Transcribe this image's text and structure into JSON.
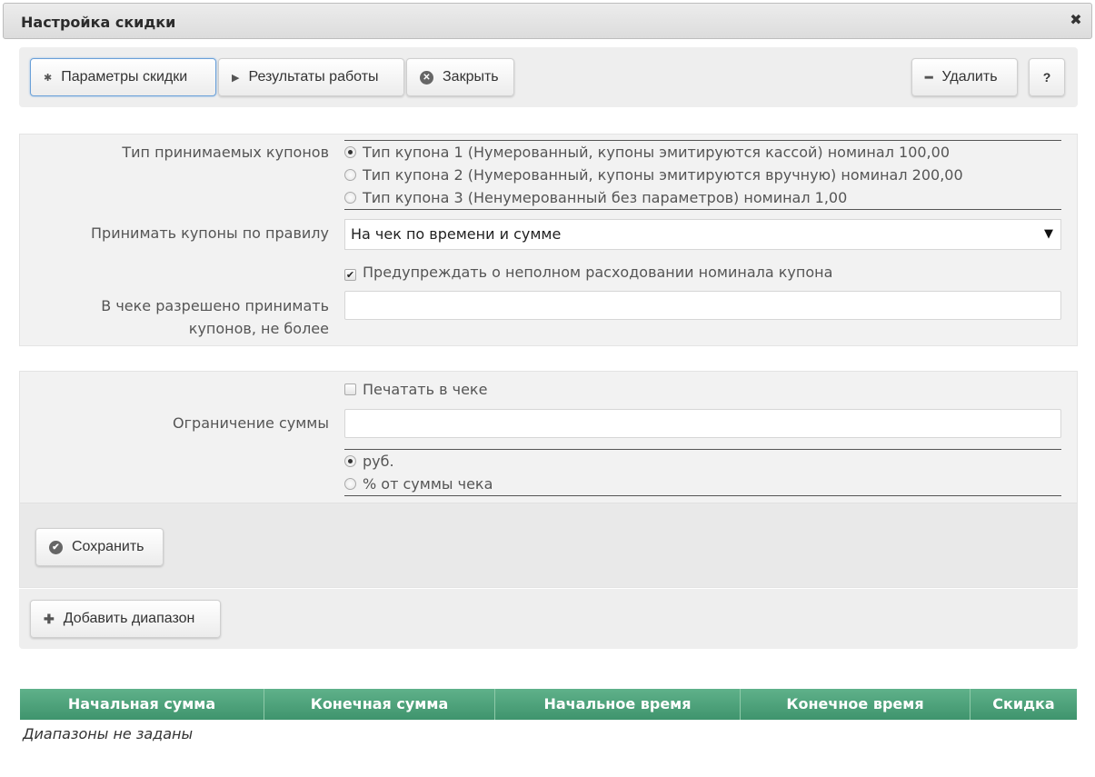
{
  "window": {
    "title": "Настройка скидки",
    "close_glyph": "✖"
  },
  "toolbar": {
    "params_label": "Параметры скидки",
    "results_label": "Результаты работы",
    "close_label": "Закрыть",
    "delete_label": "Удалить",
    "help_label": "?"
  },
  "form1": {
    "coupon_type_label": "Тип принимаемых купонов",
    "coupon_types": [
      {
        "label": "Тип купона 1 (Нумерованный, купоны эмитируются кассой) номинал 100,00",
        "selected": true
      },
      {
        "label": "Тип купона 2 (Нумерованный, купоны эмитируются вручную) номинал 200,00",
        "selected": false
      },
      {
        "label": "Тип купона 3 (Ненумерованный без параметров) номинал 1,00",
        "selected": false
      }
    ],
    "rule_label": "Принимать купоны по правилу",
    "rule_value": "На чек по времени и сумме",
    "warn_label": "Предупреждать о неполном расходовании номинала купона",
    "warn_checked": true,
    "max_coupons_label_line1": "В чеке разрешено принимать",
    "max_coupons_label_line2": "купонов, не более",
    "max_coupons_value": ""
  },
  "form2": {
    "print_label": "Печатать в чеке",
    "print_checked": false,
    "limit_label": "Ограничение суммы",
    "limit_value": "",
    "unit_options": [
      {
        "label": "руб.",
        "selected": true
      },
      {
        "label": "% от суммы чека",
        "selected": false
      }
    ],
    "save_label": "Сохранить"
  },
  "ranges": {
    "add_label": "Добавить диапазон",
    "columns": [
      "Начальная сумма",
      "Конечная сумма",
      "Начальное время",
      "Конечное время",
      "Скидка"
    ],
    "empty_text": "Диапазоны не заданы"
  },
  "colors": {
    "table_header": "#4fa37c",
    "accent_border": "#6aa0d8"
  }
}
